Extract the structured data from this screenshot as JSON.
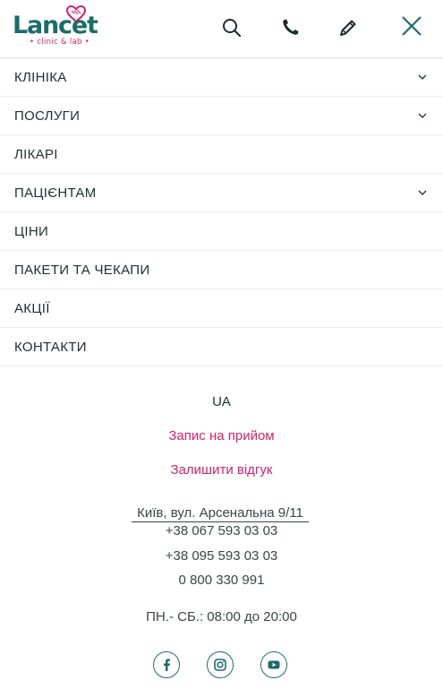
{
  "brand": {
    "logo_text": "Lancet",
    "logo_subtitle": "• clinic & lab •",
    "primary_color": "#1f6b6b",
    "accent_color": "#d4226a"
  },
  "header": {
    "icons": [
      "search-icon",
      "phone-icon",
      "pencil-icon",
      "close-icon"
    ]
  },
  "menu": {
    "items": [
      {
        "label": "КЛІНІКА",
        "has_submenu": true
      },
      {
        "label": "ПОСЛУГИ",
        "has_submenu": true
      },
      {
        "label": "ЛІКАРІ",
        "has_submenu": false
      },
      {
        "label": "ПАЦІЄНТАМ",
        "has_submenu": true
      },
      {
        "label": "ЦІНИ",
        "has_submenu": false
      },
      {
        "label": "ПАКЕТИ ТА ЧЕКАПИ",
        "has_submenu": false
      },
      {
        "label": "АКЦІЇ",
        "has_submenu": false
      },
      {
        "label": "КОНТАКТИ",
        "has_submenu": false
      }
    ]
  },
  "footer": {
    "language": "UA",
    "appointment_link": "Запис на прийом",
    "review_link": "Залишити відгук",
    "address": "Київ, вул. Арсенальна 9/11",
    "phones": [
      "+38 067 593 03 03",
      "+38 095 593 03 03",
      "0 800 330 991"
    ],
    "hours": "ПН.- СБ.: 08:00 до 20:00",
    "social": [
      "facebook-icon",
      "instagram-icon",
      "youtube-icon"
    ]
  }
}
